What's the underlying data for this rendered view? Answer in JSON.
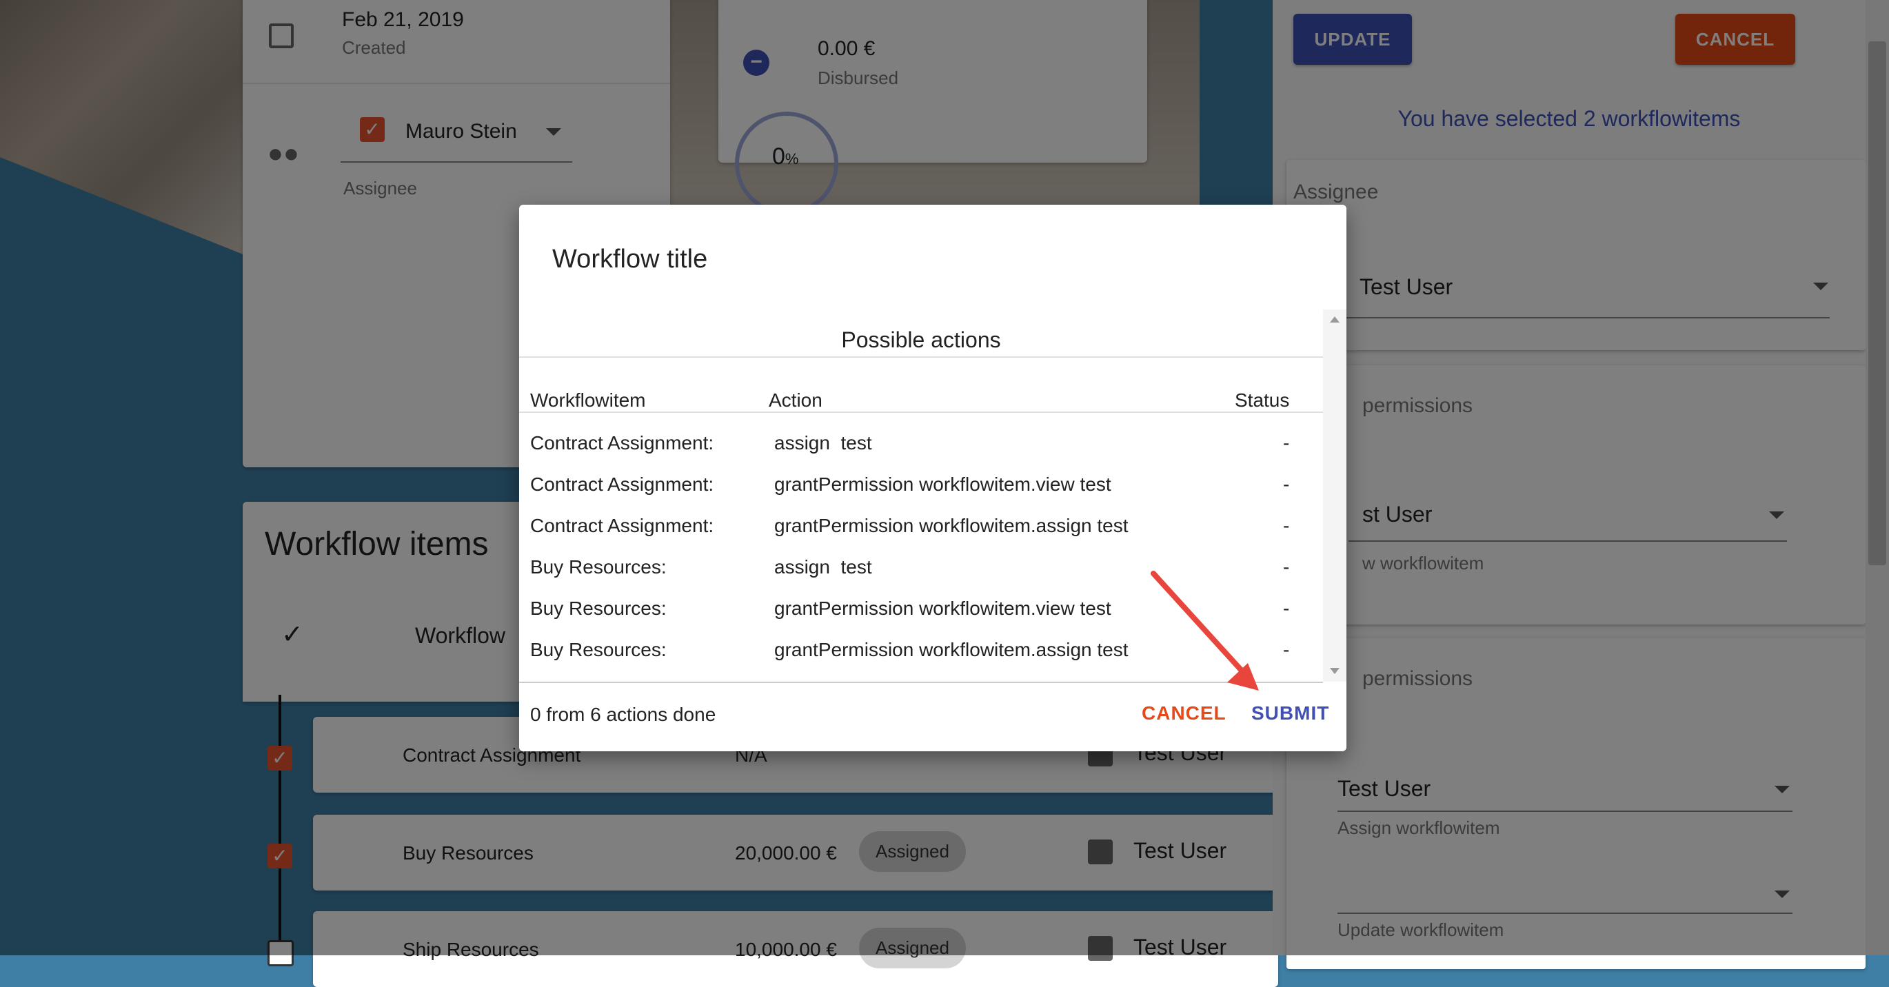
{
  "details": {
    "date": "Feb 21, 2019",
    "date_label": "Created",
    "assignee_value": "Mauro Stein",
    "assignee_label": "Assignee",
    "disbursed_amount": "0.00 €",
    "disbursed_label": "Disbursed",
    "progress_value": "0",
    "progress_unit": "%"
  },
  "workflow_list": {
    "title": "Workflow items",
    "column_workflow": "Workflow",
    "check_icon": "✓",
    "rows": [
      {
        "name": "Contract Assignment",
        "amount": "N/A",
        "status": "",
        "assignee": "Test User"
      },
      {
        "name": "Buy Resources",
        "amount": "20,000.00 €",
        "status": "Assigned",
        "assignee": "Test User"
      },
      {
        "name": "Ship Resources",
        "amount": "10,000.00 €",
        "status": "Assigned",
        "assignee": "Test User"
      }
    ]
  },
  "right_panel": {
    "update_label": "UPDATE",
    "cancel_label": "CANCEL",
    "selected_text": "You have selected 2 workflowitems",
    "assignee_heading": "Assignee",
    "assignee_value": "Test User",
    "permissions_heading_1": "permissions",
    "view_value": "st User",
    "view_label": "w workflowitem",
    "permissions_heading_2": "permissions",
    "assign_value": "Test User",
    "assign_label": "Assign workflowitem",
    "update_label2": "Update workflowitem"
  },
  "dialog": {
    "title": "Workflow title",
    "section_title": "Possible actions",
    "columns": [
      "Workflowitem",
      "Action",
      "Status"
    ],
    "rows": [
      {
        "item": "Contract Assignment:",
        "action": "assign  test",
        "status": "-"
      },
      {
        "item": "Contract Assignment:",
        "action": "grantPermission workflowitem.view test",
        "status": "-"
      },
      {
        "item": "Contract Assignment:",
        "action": "grantPermission workflowitem.assign test",
        "status": "-"
      },
      {
        "item": "Buy Resources:",
        "action": "assign  test",
        "status": "-"
      },
      {
        "item": "Buy Resources:",
        "action": "grantPermission workflowitem.view test",
        "status": "-"
      },
      {
        "item": "Buy Resources:",
        "action": "grantPermission workflowitem.assign test",
        "status": "-"
      }
    ],
    "progress_text": "0 from 6 actions done",
    "cancel_label": "CANCEL",
    "submit_label": "SUBMIT"
  },
  "colors": {
    "accent_blue": "#3f51b5",
    "accent_red": "#e64a19",
    "annotation_arrow": "#e8453c"
  }
}
